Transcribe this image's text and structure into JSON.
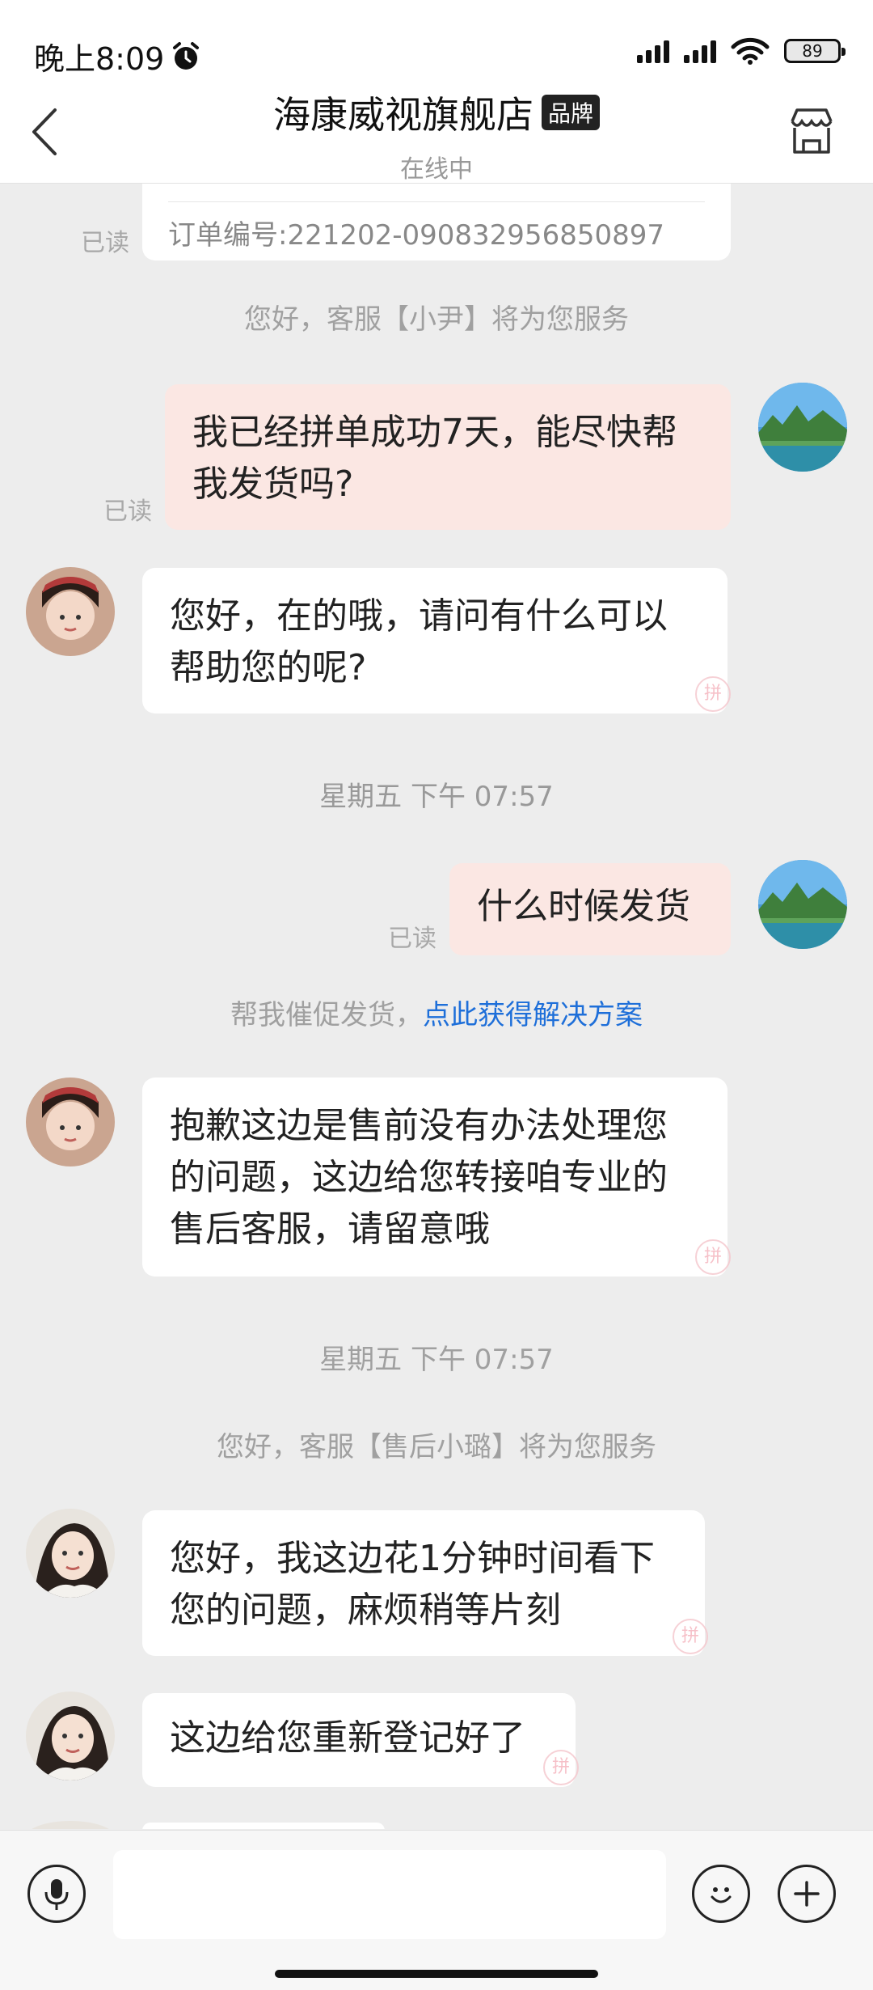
{
  "status_bar": {
    "time": "晚上8:09",
    "battery": "89"
  },
  "header": {
    "shop_name": "海康威视旗舰店",
    "badge": "品牌",
    "status": "在线中"
  },
  "order_card": {
    "order_number": "订单编号:221202-090832956850897",
    "read_label": "已读"
  },
  "system_messages": {
    "agent_intro_1": "您好，客服【小尹】将为您服务",
    "time_1": "星期五 下午 07:57",
    "urge_text": "帮我催促发货，",
    "urge_link": "点此获得解决方案",
    "time_2": "星期五 下午 07:57",
    "agent_intro_2": "您好，客服【售后小璐】将为您服务"
  },
  "messages": [
    {
      "from": "me",
      "text_line1": "我已经拼单成功7天，能尽快帮",
      "text_line2": "我发货吗?",
      "read": "已读"
    },
    {
      "from": "agent",
      "text_line1": "您好，在的哦，请问有什么可以",
      "text_line2": "帮助您的呢?"
    },
    {
      "from": "me",
      "text_line1": "什么时候发货",
      "read": "已读"
    },
    {
      "from": "agent",
      "text_line1": "抱歉这边是售前没有办法处理您",
      "text_line2": "的问题，这边给您转接咱专业的",
      "text_line3": "售后客服，请留意哦"
    },
    {
      "from": "agent",
      "text_line1": "您好，我这边花1分钟时间看下",
      "text_line2": "您的问题，麻烦稍等片刻"
    },
    {
      "from": "agent",
      "text_line1": "这边给您重新登记好了"
    }
  ],
  "stamp_char": "拼",
  "input": {
    "placeholder": ""
  },
  "icons": {
    "back": "back-chevron-icon",
    "store": "store-icon",
    "mic": "microphone-icon",
    "emoji": "emoji-icon",
    "add": "plus-icon",
    "alarm": "alarm-icon"
  }
}
